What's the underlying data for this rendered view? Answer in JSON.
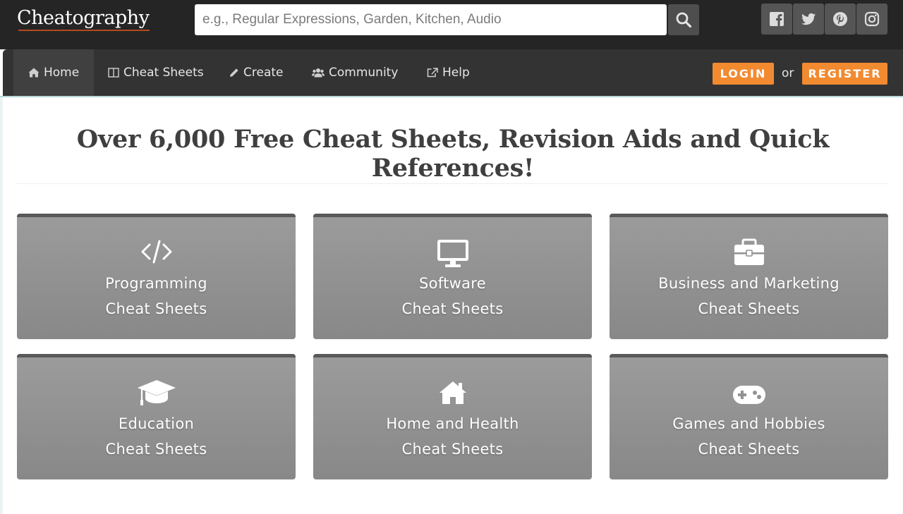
{
  "header": {
    "logo": "Cheatography",
    "search": {
      "placeholder": "e.g., Regular Expressions, Garden, Kitchen, Audio",
      "value": ""
    },
    "social_icons": [
      "facebook-icon",
      "twitter-icon",
      "pinterest-icon",
      "instagram-icon"
    ]
  },
  "nav": {
    "items": [
      {
        "label": "Home",
        "icon": "home-icon"
      },
      {
        "label": "Cheat Sheets",
        "icon": "book-icon"
      },
      {
        "label": "Create",
        "icon": "pencil-icon"
      },
      {
        "label": "Community",
        "icon": "users-icon"
      },
      {
        "label": "Help",
        "icon": "external-link-icon"
      }
    ],
    "login": "LOGIN",
    "or": "or",
    "register": "REGISTER"
  },
  "main": {
    "headline": "Over 6,000 Free Cheat Sheets, Revision Aids and Quick References!",
    "categories": [
      {
        "title": "Programming",
        "subtitle": "Cheat Sheets",
        "icon": "code-icon"
      },
      {
        "title": "Software",
        "subtitle": "Cheat Sheets",
        "icon": "monitor-icon"
      },
      {
        "title": "Business and Marketing",
        "subtitle": "Cheat Sheets",
        "icon": "briefcase-icon"
      },
      {
        "title": "Education",
        "subtitle": "Cheat Sheets",
        "icon": "graduation-cap-icon"
      },
      {
        "title": "Home and Health",
        "subtitle": "Cheat Sheets",
        "icon": "home-icon"
      },
      {
        "title": "Games and Hobbies",
        "subtitle": "Cheat Sheets",
        "icon": "gamepad-icon"
      }
    ]
  },
  "colors": {
    "topbar": "#252525",
    "navbar": "#333333",
    "accent_orange": "#f28a30",
    "tile_gray": "#919191",
    "headline_text": "#3f3f3f"
  }
}
